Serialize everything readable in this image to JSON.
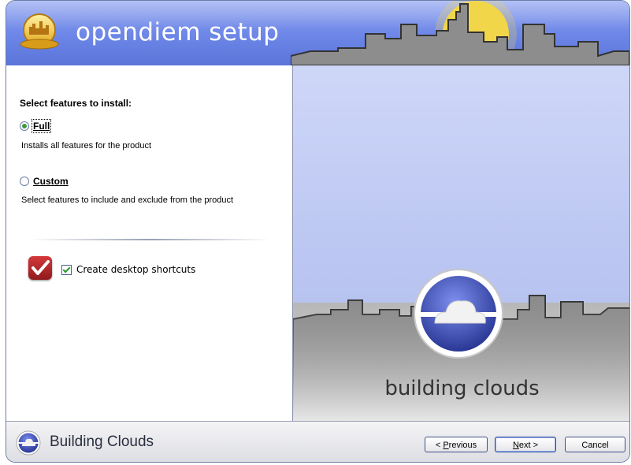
{
  "header": {
    "title": "opendiem setup",
    "logo_icon": "opendiem-logo-icon"
  },
  "options": {
    "heading": "Select features to install:",
    "full": {
      "label": "Full",
      "description": "Installs all features for the product",
      "selected": true
    },
    "custom": {
      "label": "Custom",
      "description": "Select features to include and exclude from the product",
      "selected": false
    }
  },
  "shortcuts": {
    "label": "Create desktop shortcuts",
    "checked": true
  },
  "banner": {
    "tagline": "building clouds"
  },
  "footer": {
    "title": "Building Clouds",
    "previous": {
      "prefix": "< ",
      "mnemonic": "P",
      "rest": "revious"
    },
    "next": {
      "mnemonic": "N",
      "rest": "ext >"
    },
    "cancel": "Cancel"
  },
  "colors": {
    "header_blue": "#6a84e6",
    "panel_blue": "#bcc7f2",
    "accent_yellow": "#f2d64a",
    "radio_green": "#3c9c3c",
    "shortcut_red": "#c0292c"
  }
}
